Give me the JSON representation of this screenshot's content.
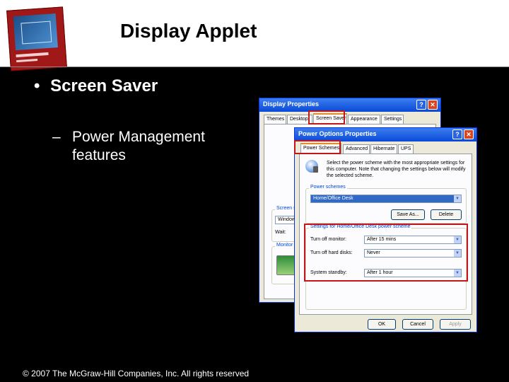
{
  "slide": {
    "title": "Display Applet",
    "bullet_main": "Screen Saver",
    "bullet_sub_dash": "–",
    "bullet_sub": "Power Management features",
    "bullet_marker": "•",
    "footer": "© 2007 The McGraw-Hill Companies, Inc. All rights reserved"
  },
  "display_properties": {
    "title": "Display Properties",
    "help": "?",
    "close": "✕",
    "tabs": [
      "Themes",
      "Desktop",
      "Screen Saver",
      "Appearance",
      "Settings"
    ],
    "active_tab": "Screen Saver",
    "screen_saver_group": "Screen saver",
    "screen_saver_value": "Windows XP",
    "wait_label": "Wait:",
    "monitor_power_group": "Monitor power"
  },
  "power_options": {
    "title": "Power Options Properties",
    "help": "?",
    "close": "✕",
    "tabs": [
      "Power Schemes",
      "Advanced",
      "Hibernate",
      "UPS"
    ],
    "active_tab": "Power Schemes",
    "description": "Select the power scheme with the most appropriate settings for this computer. Note that changing the settings below will modify the selected scheme.",
    "schemes_label": "Power schemes",
    "scheme_value": "Home/Office Desk",
    "save_as_button": "Save As...",
    "delete_button": "Delete",
    "settings_label": "Settings for Home/Office Desk power scheme",
    "monitor_label": "Turn off monitor:",
    "monitor_value": "After 15 mins",
    "harddisk_label": "Turn off hard disks:",
    "harddisk_value": "Never",
    "standby_label": "System standby:",
    "standby_value": "After 1 hour",
    "ok_button": "OK",
    "cancel_button": "Cancel",
    "apply_button": "Apply"
  },
  "colors": {
    "highlight": "#c0161c",
    "titlebar": "#0a49d6",
    "background": "#000000"
  }
}
